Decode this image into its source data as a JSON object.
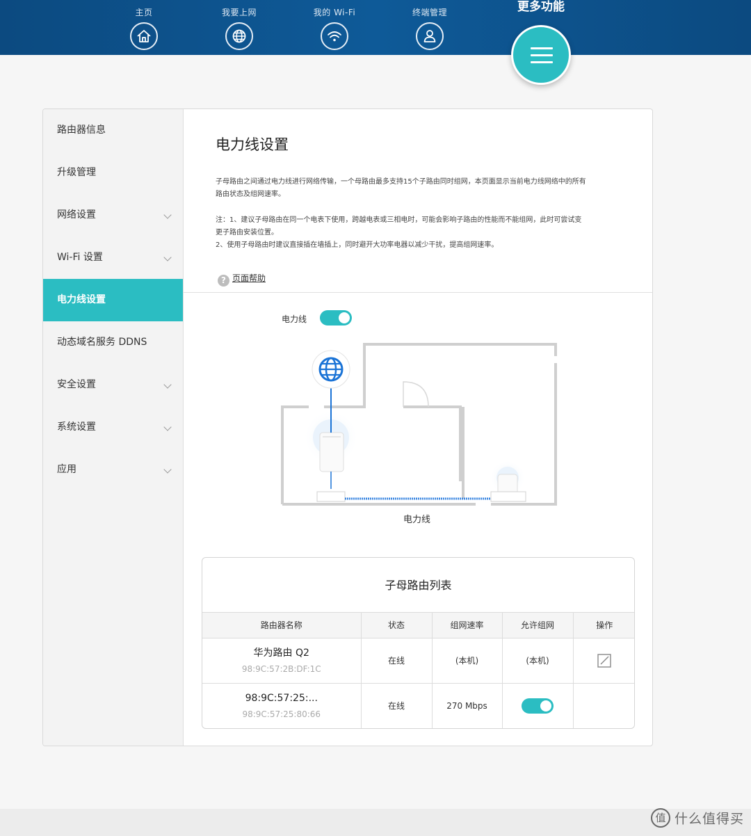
{
  "nav": {
    "items": [
      {
        "label": "主页",
        "icon": "home-icon"
      },
      {
        "label": "我要上网",
        "icon": "globe-icon"
      },
      {
        "label": "我的 Wi-Fi",
        "icon": "wifi-icon"
      },
      {
        "label": "终端管理",
        "icon": "user-icon"
      }
    ],
    "more_label": "更多功能",
    "more_icon": "menu-icon"
  },
  "sidebar": {
    "items": [
      {
        "label": "路由器信息",
        "expandable": false,
        "active": false
      },
      {
        "label": "升级管理",
        "expandable": false,
        "active": false
      },
      {
        "label": "网络设置",
        "expandable": true,
        "active": false
      },
      {
        "label": "Wi-Fi 设置",
        "expandable": true,
        "active": false
      },
      {
        "label": "电力线设置",
        "expandable": false,
        "active": true
      },
      {
        "label": "动态域名服务 DDNS",
        "expandable": false,
        "active": false
      },
      {
        "label": "安全设置",
        "expandable": true,
        "active": false
      },
      {
        "label": "系统设置",
        "expandable": true,
        "active": false
      },
      {
        "label": "应用",
        "expandable": true,
        "active": false
      }
    ]
  },
  "page": {
    "title": "电力线设置",
    "desc_line1": "子母路由之间通过电力线进行网络传输，一个母路由最多支持15个子路由同时组网，本页面显示当前电力线网络中的所有",
    "desc_line2": "路由状态及组网速率。",
    "note_line1": "注：1、建议子母路由在同一个电表下使用，跨越电表或三相电时，可能会影响子路由的性能而不能组网，此时可尝试变",
    "note_line2": "更子路由安装位置。",
    "note_line3": "2、使用子母路由时建议直接插在墙插上，同时避开大功率电器以减少干扰，提高组网速率。",
    "help_label": "页面帮助",
    "plc_label": "电力线",
    "plc_enabled": true,
    "diagram_caption": "电力线"
  },
  "table": {
    "title": "子母路由列表",
    "headers": [
      "路由器名称",
      "状态",
      "组网速率",
      "允许组网",
      "操作"
    ],
    "rows": [
      {
        "name": "华为路由 Q2",
        "mac": "98:9C:57:2B:DF:1C",
        "status": "在线",
        "rate": "(本机)",
        "allow": "(本机)",
        "action": "edit-icon"
      },
      {
        "name": "98:9C:57:25:...",
        "mac": "98:9C:57:25:80:66",
        "status": "在线",
        "rate": "270 Mbps",
        "allow_toggle": true
      }
    ]
  },
  "watermark": {
    "badge": "值",
    "text": "什么值得买"
  },
  "colors": {
    "nav_bg": "#0e5a98",
    "accent": "#2bbdc2",
    "plc_line": "#3a86e0"
  }
}
